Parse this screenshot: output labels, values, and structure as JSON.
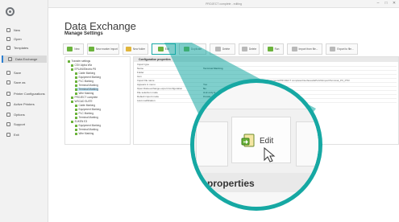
{
  "window": {
    "title": "PROJECT complete - editing",
    "min_glyph": "–",
    "max_glyph": "□",
    "close_glyph": "✕"
  },
  "sidebar": {
    "items": [
      {
        "label": "New",
        "icon": "new-icon"
      },
      {
        "label": "Open",
        "icon": "open-icon"
      },
      {
        "label": "Templates",
        "icon": "templates-icon"
      },
      {
        "label": "Data Exchange",
        "icon": "data-exchange-icon",
        "active": true
      },
      {
        "label": "Save",
        "icon": "save-icon"
      },
      {
        "label": "Save as",
        "icon": "save-as-icon"
      },
      {
        "label": "Printer Configurations",
        "icon": "printer-config-icon"
      },
      {
        "label": "Active Printers",
        "icon": "printer-icon"
      },
      {
        "label": "Options",
        "icon": "options-icon"
      },
      {
        "label": "Support",
        "icon": "support-icon"
      },
      {
        "label": "Exit",
        "icon": "exit-icon"
      }
    ]
  },
  "header": {
    "title": "Data Exchange",
    "subtitle": "Manage Settings"
  },
  "toolbar": {
    "buttons": [
      {
        "label": "New",
        "icon": "new-icon"
      },
      {
        "label": "New marker import",
        "icon": "new-import-icon"
      },
      {
        "label": "New folder",
        "icon": "new-folder-icon"
      },
      {
        "label": "Edit",
        "icon": "edit-icon",
        "selected": true
      },
      {
        "label": "Duplicate",
        "icon": "duplicate-icon"
      },
      {
        "label": "Delete",
        "icon": "delete-icon"
      },
      {
        "label": "Delete",
        "icon": "delete-icon"
      },
      {
        "label": "Run",
        "icon": "run-icon"
      },
      {
        "label": "Import from file...",
        "icon": "import-icon"
      },
      {
        "label": "Export to file...",
        "icon": "export-icon"
      }
    ]
  },
  "tree": {
    "nodes": [
      {
        "label": "Transfer settings",
        "depth": 0
      },
      {
        "label": "CSV Alpha Wiz",
        "depth": 1
      },
      {
        "label": "EPLAN/Electric P8",
        "depth": 1
      },
      {
        "label": "Cable Marking",
        "depth": 2
      },
      {
        "label": "Equipment Marking",
        "depth": 2
      },
      {
        "label": "PLC Marking",
        "depth": 2
      },
      {
        "label": "Terminal Marking",
        "depth": 2
      },
      {
        "label": "Terminal Marking",
        "depth": 2,
        "selected": true
      },
      {
        "label": "Wire Marking",
        "depth": 2
      },
      {
        "label": "PROJECT complete",
        "depth": 1
      },
      {
        "label": "WSCAD SUITE",
        "depth": 1
      },
      {
        "label": "Cable Marking",
        "depth": 2
      },
      {
        "label": "Equipment Marking",
        "depth": 2
      },
      {
        "label": "PLC Marking",
        "depth": 2
      },
      {
        "label": "Terminal Marking",
        "depth": 2
      },
      {
        "label": "ZUKEN E3",
        "depth": 1
      },
      {
        "label": "Equipment Marking",
        "depth": 2
      },
      {
        "label": "Terminal Marking",
        "depth": 2
      },
      {
        "label": "Wire Marking",
        "depth": 2
      }
    ]
  },
  "properties": {
    "header": "Configuration properties",
    "rows": [
      {
        "name": "Import type",
        "value": ""
      },
      {
        "name": "Name",
        "value": "Terminal Marking"
      },
      {
        "name": "Folder",
        "value": ""
      },
      {
        "name": "Icon",
        "value": ""
      },
      {
        "name": "Import file name",
        "value": "",
        "long": "C:\\Users\\public\\Documents\\PROJECT complete\\Interfaces\\EPLAN\\Import\\Terminal_PX_PTR"
      },
      {
        "name": "Appears in menu",
        "value": "Yes"
      },
      {
        "name": "Open Data exchange export Configuration",
        "value": "No"
      },
      {
        "name": "File selection mode",
        "value": "Ask only if..."
      },
      {
        "name": "Default import mode",
        "value": "Create new project"
      },
      {
        "name": "Last modification",
        "value": ""
      }
    ]
  },
  "zoom": {
    "edit_label": "Edit",
    "properties_label": "properties",
    "accent": "#16a8a3"
  },
  "colors": {
    "accent": "#16a8a3",
    "active_nav": "#2d7fd0",
    "icon_green": "#6bb33c"
  }
}
